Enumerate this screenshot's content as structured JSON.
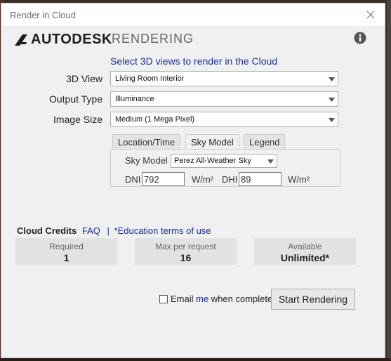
{
  "window": {
    "title": "Render in Cloud"
  },
  "brand": {
    "logo_text": "AUTODESK",
    "product": "RENDERING"
  },
  "headline": "Select 3D views to render in the Cloud",
  "form": {
    "view_label": "3D View",
    "view_value": "Living Room Interior",
    "output_label": "Output Type",
    "output_value": "Illuminance",
    "size_label": "Image Size",
    "size_value": "Medium (1 Mega Pixel)"
  },
  "tabs": [
    {
      "label": "Location/Time",
      "active": false
    },
    {
      "label": "Sky Model",
      "active": true
    },
    {
      "label": "Legend",
      "active": false
    }
  ],
  "sky": {
    "model_label": "Sky Model",
    "model_value": "Perez All-Weather Sky",
    "dni_label": "DNI",
    "dni_value": "792",
    "dni_unit": "W/m²",
    "dhi_label": "DHI",
    "dhi_value": "89",
    "dhi_unit": "W/m²"
  },
  "credits": {
    "title": "Cloud Credits",
    "faq": "FAQ",
    "separator": "|",
    "edu_terms": "*Education terms of use",
    "required_label": "Required",
    "required_value": "1",
    "max_label": "Max per request",
    "max_value": "16",
    "available_label": "Available",
    "available_value": "Unlimited*"
  },
  "email": {
    "prefix": "Email ",
    "me": "me",
    "suffix": " when complete",
    "checked": false
  },
  "start_button": "Start Rendering",
  "colors": {
    "link": "#1a2fa0",
    "dialog_bg": "#f0f0f0"
  }
}
